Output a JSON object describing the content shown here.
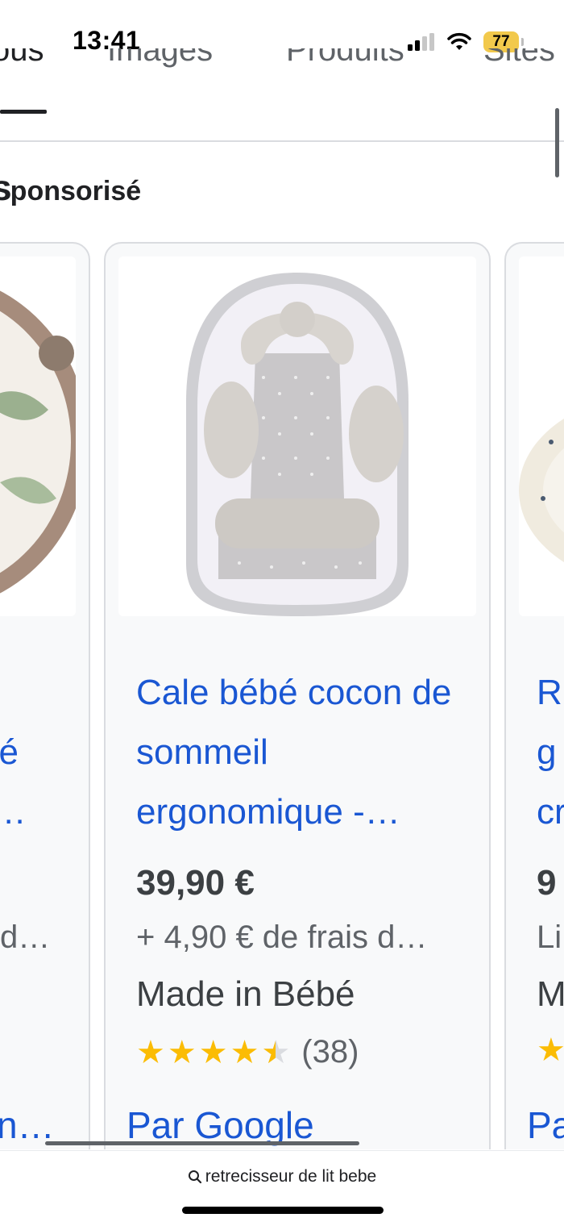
{
  "status_bar": {
    "time": "13:41",
    "battery": "77"
  },
  "tabs": [
    {
      "label": "Tous"
    },
    {
      "label": "Images"
    },
    {
      "label": "Produits"
    },
    {
      "label": "Sites"
    }
  ],
  "sponsored_label": "Sponsorisé",
  "cards": {
    "left": {
      "title_lines": [
        "-",
        "bé",
        "r…"
      ],
      "shipping": "d…",
      "footer": "n…"
    },
    "main": {
      "title": "Cale bébé cocon de sommeil ergonomique -…",
      "price": "39,90 €",
      "shipping": "+ 4,90 € de frais d…",
      "store": "Made in Bébé",
      "rating": 4.5,
      "reviews": "(38)",
      "by_google": "Par Google"
    },
    "right": {
      "title_lines": [
        "R",
        "g",
        "cr"
      ],
      "price": "9",
      "shipping": "Li",
      "store": "M",
      "footer": "Pa"
    }
  },
  "bottom_bar": {
    "url": "retrecisseur de lit bebe"
  },
  "colors": {
    "link": "#1a57d3",
    "star": "#fbbc04",
    "battery": "#f2c94c"
  }
}
